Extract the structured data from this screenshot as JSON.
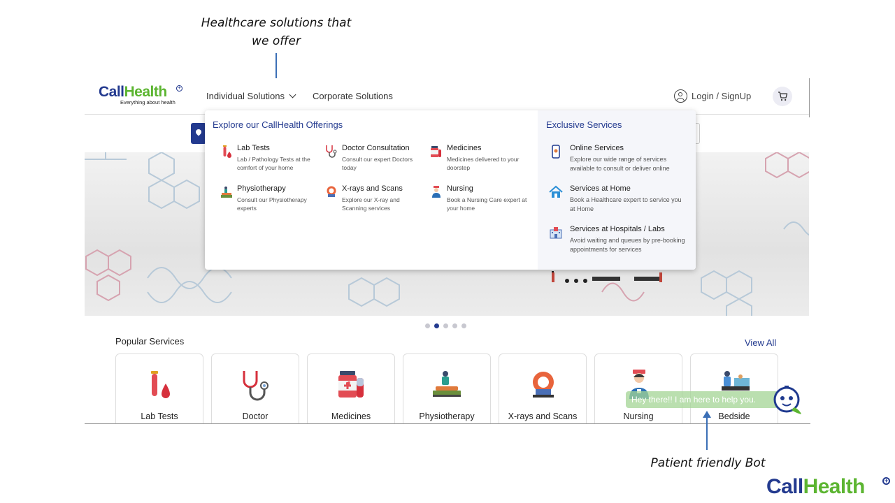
{
  "annotations": {
    "top_line1": "Healthcare solutions that",
    "top_line2": "we offer",
    "bottom": "Patient friendly Bot"
  },
  "brand": {
    "logo_part1": "Call",
    "logo_part2": "Health",
    "tagline": "Everything about health",
    "primary_color": "#233a8f",
    "accent_color": "#5cb531"
  },
  "nav": {
    "individual": "Individual Solutions",
    "corporate": "Corporate Solutions",
    "login": "Login / SignUp"
  },
  "dropdown": {
    "offerings_title": "Explore our CallHealth Offerings",
    "offerings": [
      {
        "name": "Lab Tests",
        "desc": "Lab / Pathology Tests at the comfort of your home",
        "icon": "test-tube-icon"
      },
      {
        "name": "Doctor Consultation",
        "desc": "Consult our expert Doctors today",
        "icon": "stethoscope-icon"
      },
      {
        "name": "Medicines",
        "desc": "Medicines delivered to your doorstep",
        "icon": "medicine-icon"
      },
      {
        "name": "Physiotherapy",
        "desc": "Consult our Physiotherapy experts",
        "icon": "physiotherapy-icon"
      },
      {
        "name": "X-rays and Scans",
        "desc": "Explore our X-ray and Scanning services",
        "icon": "scanner-icon"
      },
      {
        "name": "Nursing",
        "desc": "Book a Nursing Care expert at your home",
        "icon": "nurse-icon"
      }
    ],
    "exclusive_title": "Exclusive Services",
    "exclusive": [
      {
        "name": "Online Services",
        "desc": "Explore our wide range of services available to consult or deliver online",
        "icon": "phone-icon"
      },
      {
        "name": "Services at Home",
        "desc": "Book a Healthcare expert to service you at Home",
        "icon": "home-icon"
      },
      {
        "name": "Services at Hospitals / Labs",
        "desc": "Avoid waiting and queues by pre-booking appointments for services",
        "icon": "hospital-icon"
      }
    ]
  },
  "carousel": {
    "total": 5,
    "active_index": 1
  },
  "popular": {
    "title": "Popular Services",
    "view_all": "View All",
    "items": [
      {
        "label": "Lab Tests",
        "icon": "test-tube-icon"
      },
      {
        "label": "Doctor",
        "icon": "stethoscope-icon"
      },
      {
        "label": "Medicines",
        "icon": "medicine-icon"
      },
      {
        "label": "Physiotherapy",
        "icon": "physiotherapy-icon"
      },
      {
        "label": "X-rays and Scans",
        "icon": "scanner-icon"
      },
      {
        "label": "Nursing",
        "icon": "nurse-icon"
      },
      {
        "label": "Bedside",
        "icon": "bedside-icon"
      }
    ]
  },
  "bot": {
    "message": "Hey there!! I am here to help you."
  }
}
